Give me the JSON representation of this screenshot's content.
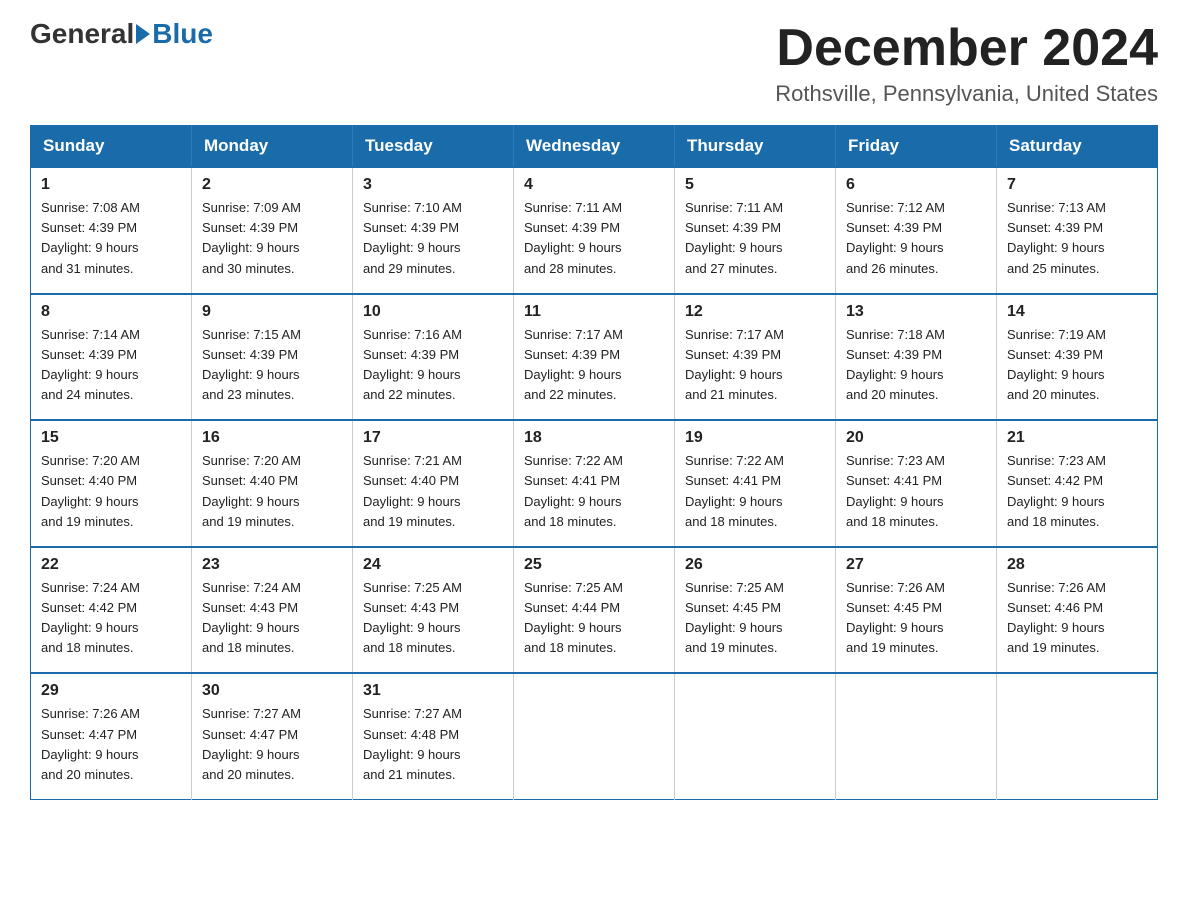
{
  "logo": {
    "general": "General",
    "blue": "Blue"
  },
  "title": {
    "month": "December 2024",
    "location": "Rothsville, Pennsylvania, United States"
  },
  "weekdays": [
    "Sunday",
    "Monday",
    "Tuesday",
    "Wednesday",
    "Thursday",
    "Friday",
    "Saturday"
  ],
  "weeks": [
    [
      {
        "day": "1",
        "sunrise": "7:08 AM",
        "sunset": "4:39 PM",
        "daylight": "9 hours and 31 minutes."
      },
      {
        "day": "2",
        "sunrise": "7:09 AM",
        "sunset": "4:39 PM",
        "daylight": "9 hours and 30 minutes."
      },
      {
        "day": "3",
        "sunrise": "7:10 AM",
        "sunset": "4:39 PM",
        "daylight": "9 hours and 29 minutes."
      },
      {
        "day": "4",
        "sunrise": "7:11 AM",
        "sunset": "4:39 PM",
        "daylight": "9 hours and 28 minutes."
      },
      {
        "day": "5",
        "sunrise": "7:11 AM",
        "sunset": "4:39 PM",
        "daylight": "9 hours and 27 minutes."
      },
      {
        "day": "6",
        "sunrise": "7:12 AM",
        "sunset": "4:39 PM",
        "daylight": "9 hours and 26 minutes."
      },
      {
        "day": "7",
        "sunrise": "7:13 AM",
        "sunset": "4:39 PM",
        "daylight": "9 hours and 25 minutes."
      }
    ],
    [
      {
        "day": "8",
        "sunrise": "7:14 AM",
        "sunset": "4:39 PM",
        "daylight": "9 hours and 24 minutes."
      },
      {
        "day": "9",
        "sunrise": "7:15 AM",
        "sunset": "4:39 PM",
        "daylight": "9 hours and 23 minutes."
      },
      {
        "day": "10",
        "sunrise": "7:16 AM",
        "sunset": "4:39 PM",
        "daylight": "9 hours and 22 minutes."
      },
      {
        "day": "11",
        "sunrise": "7:17 AM",
        "sunset": "4:39 PM",
        "daylight": "9 hours and 22 minutes."
      },
      {
        "day": "12",
        "sunrise": "7:17 AM",
        "sunset": "4:39 PM",
        "daylight": "9 hours and 21 minutes."
      },
      {
        "day": "13",
        "sunrise": "7:18 AM",
        "sunset": "4:39 PM",
        "daylight": "9 hours and 20 minutes."
      },
      {
        "day": "14",
        "sunrise": "7:19 AM",
        "sunset": "4:39 PM",
        "daylight": "9 hours and 20 minutes."
      }
    ],
    [
      {
        "day": "15",
        "sunrise": "7:20 AM",
        "sunset": "4:40 PM",
        "daylight": "9 hours and 19 minutes."
      },
      {
        "day": "16",
        "sunrise": "7:20 AM",
        "sunset": "4:40 PM",
        "daylight": "9 hours and 19 minutes."
      },
      {
        "day": "17",
        "sunrise": "7:21 AM",
        "sunset": "4:40 PM",
        "daylight": "9 hours and 19 minutes."
      },
      {
        "day": "18",
        "sunrise": "7:22 AM",
        "sunset": "4:41 PM",
        "daylight": "9 hours and 18 minutes."
      },
      {
        "day": "19",
        "sunrise": "7:22 AM",
        "sunset": "4:41 PM",
        "daylight": "9 hours and 18 minutes."
      },
      {
        "day": "20",
        "sunrise": "7:23 AM",
        "sunset": "4:41 PM",
        "daylight": "9 hours and 18 minutes."
      },
      {
        "day": "21",
        "sunrise": "7:23 AM",
        "sunset": "4:42 PM",
        "daylight": "9 hours and 18 minutes."
      }
    ],
    [
      {
        "day": "22",
        "sunrise": "7:24 AM",
        "sunset": "4:42 PM",
        "daylight": "9 hours and 18 minutes."
      },
      {
        "day": "23",
        "sunrise": "7:24 AM",
        "sunset": "4:43 PM",
        "daylight": "9 hours and 18 minutes."
      },
      {
        "day": "24",
        "sunrise": "7:25 AM",
        "sunset": "4:43 PM",
        "daylight": "9 hours and 18 minutes."
      },
      {
        "day": "25",
        "sunrise": "7:25 AM",
        "sunset": "4:44 PM",
        "daylight": "9 hours and 18 minutes."
      },
      {
        "day": "26",
        "sunrise": "7:25 AM",
        "sunset": "4:45 PM",
        "daylight": "9 hours and 19 minutes."
      },
      {
        "day": "27",
        "sunrise": "7:26 AM",
        "sunset": "4:45 PM",
        "daylight": "9 hours and 19 minutes."
      },
      {
        "day": "28",
        "sunrise": "7:26 AM",
        "sunset": "4:46 PM",
        "daylight": "9 hours and 19 minutes."
      }
    ],
    [
      {
        "day": "29",
        "sunrise": "7:26 AM",
        "sunset": "4:47 PM",
        "daylight": "9 hours and 20 minutes."
      },
      {
        "day": "30",
        "sunrise": "7:27 AM",
        "sunset": "4:47 PM",
        "daylight": "9 hours and 20 minutes."
      },
      {
        "day": "31",
        "sunrise": "7:27 AM",
        "sunset": "4:48 PM",
        "daylight": "9 hours and 21 minutes."
      },
      null,
      null,
      null,
      null
    ]
  ],
  "labels": {
    "sunrise": "Sunrise:",
    "sunset": "Sunset:",
    "daylight": "Daylight:"
  }
}
